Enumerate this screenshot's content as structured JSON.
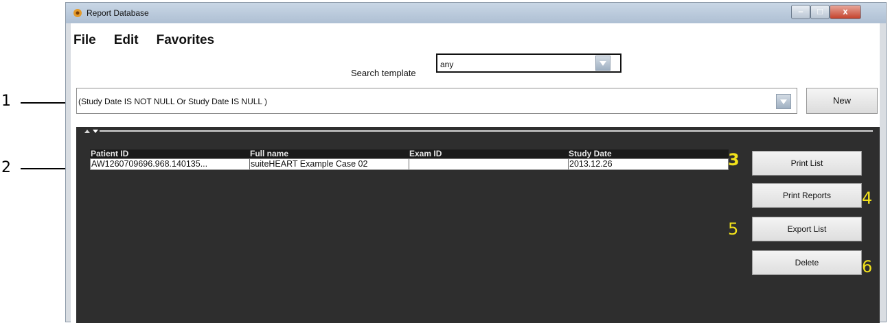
{
  "window": {
    "title": "Report Database",
    "minimize_glyph": "–",
    "maximize_glyph": "□",
    "close_glyph": "x"
  },
  "menu": [
    "File",
    "Edit",
    "Favorites"
  ],
  "search": {
    "label": "Search template",
    "value": "any"
  },
  "query": {
    "value": "(Study Date IS NOT NULL Or Study Date IS NULL )"
  },
  "new_button": "New",
  "table": {
    "columns": [
      "Patient ID",
      "Full name",
      "Exam ID",
      "Study Date"
    ],
    "rows": [
      [
        "AW1260709696.968.140135...",
        "suiteHEART Example Case 02",
        "",
        "2013.12.26"
      ]
    ]
  },
  "buttons": {
    "print_list": "Print List",
    "print_reports": "Print Reports",
    "export_list": "Export List",
    "delete": "Delete"
  },
  "callouts": {
    "one": "1",
    "two": "2",
    "three": "3",
    "four": "4",
    "five": "5",
    "six": "6"
  },
  "colors": {
    "callout_yellow": "#f2e21b",
    "panel_dark": "#2e2e2e"
  }
}
